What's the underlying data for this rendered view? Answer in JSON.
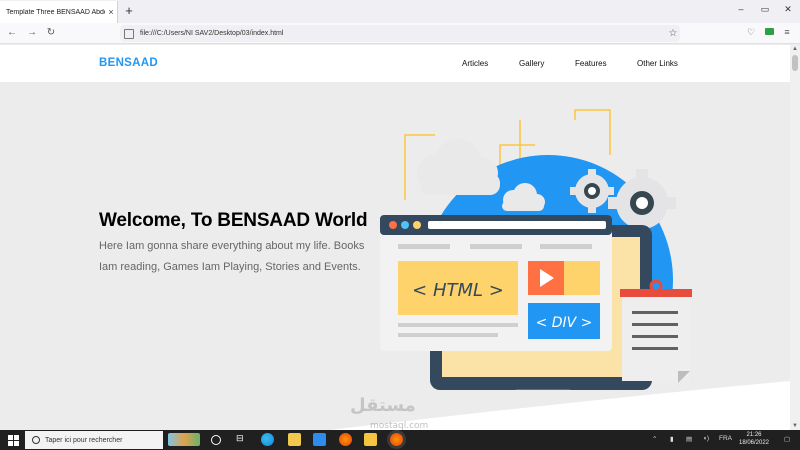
{
  "browser": {
    "tab_title": "Template Three BENSAAD Abdelhak",
    "tab_close": "×",
    "new_tab": "+",
    "url": "file:///C:/Users/NI SAV2/Desktop/03/index.html",
    "min": "–",
    "restore": "▭",
    "close": "✕"
  },
  "page": {
    "logo": "BENSAAD",
    "nav": [
      "Articles",
      "Gallery",
      "Features",
      "Other Links"
    ],
    "landing": {
      "title": "Welcome, To BENSAAD World",
      "description": "Here Iam gonna share everything about my life. Books Iam reading, Games Iam Playing, Stories and Events."
    },
    "illustration": {
      "html_label": "< HTML >",
      "div_label": "< DIV >"
    }
  },
  "taskbar": {
    "search_placeholder": "Taper ici pour rechercher",
    "language": "FRA",
    "time": "21:26",
    "date": "18/06/2022"
  },
  "watermark": {
    "main": "مستقل",
    "sub": "mostaql.com"
  },
  "colors": {
    "brand": "#2196f3",
    "illustration_blue": "#2196f3",
    "html_yellow": "#ffd36b",
    "play_orange": "#ff7043",
    "laptop_dark": "#34495e"
  }
}
